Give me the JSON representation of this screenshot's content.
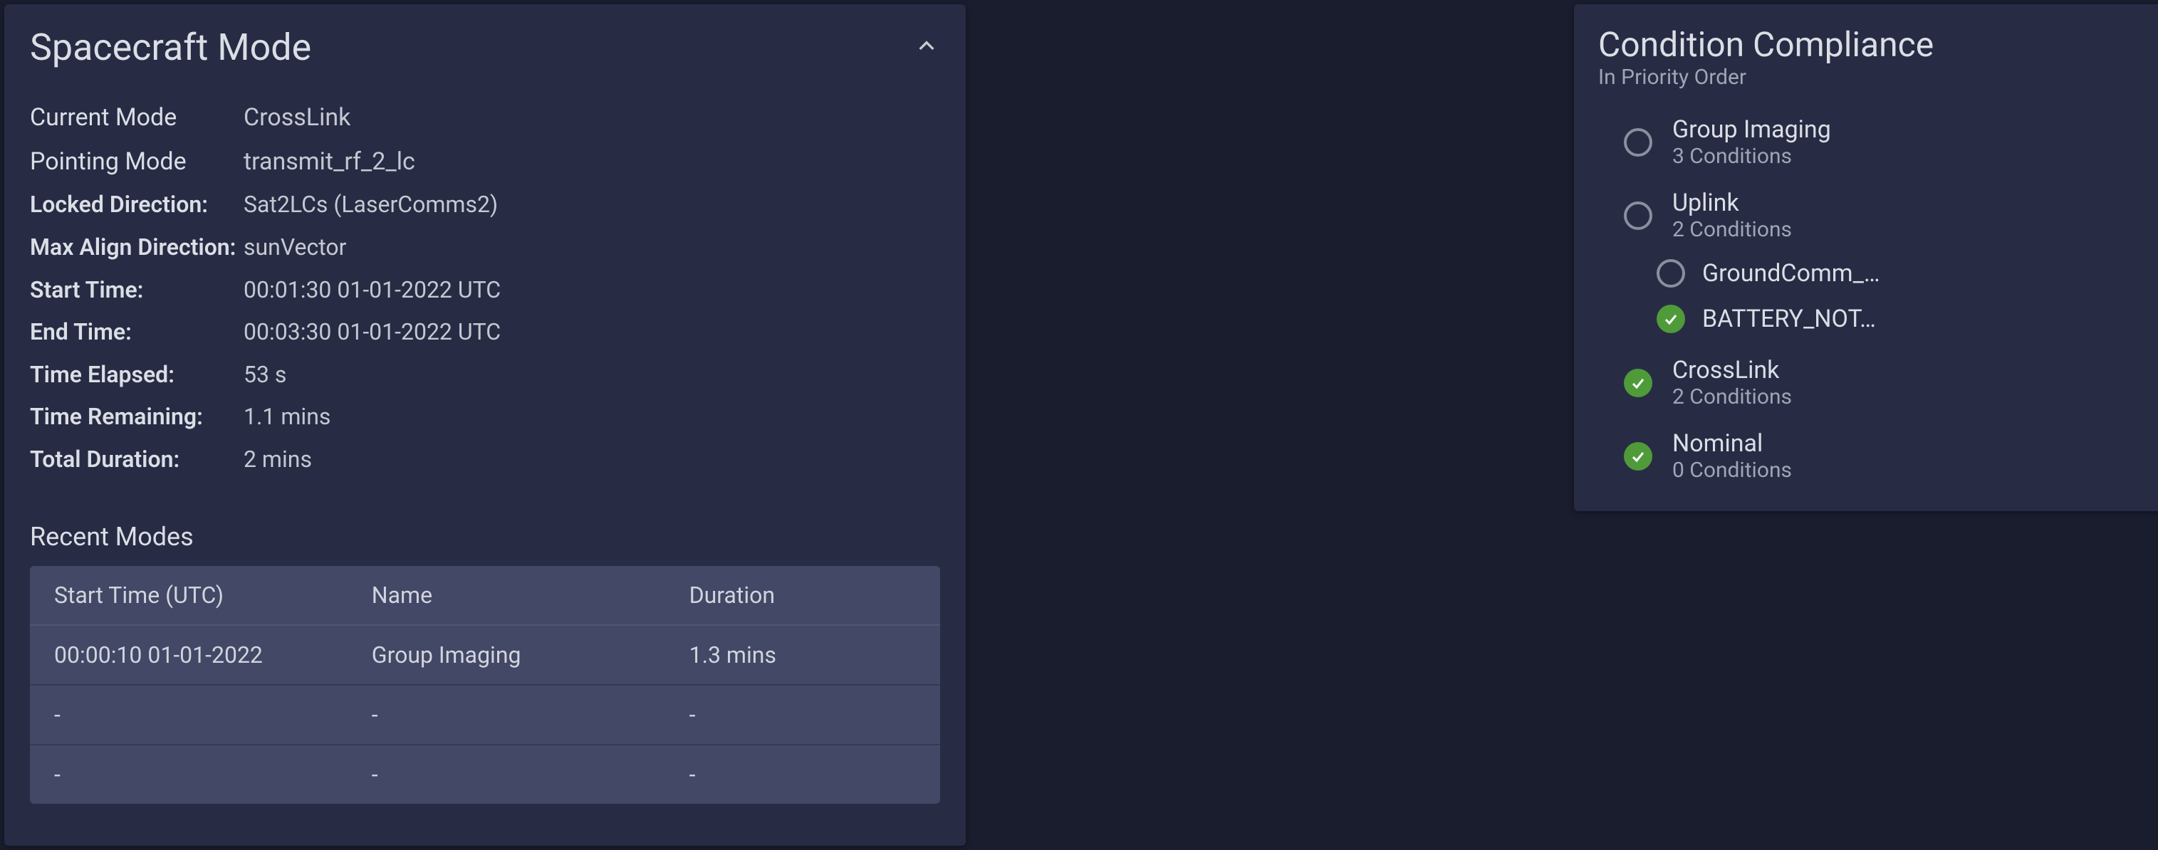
{
  "spacecraft_mode": {
    "title": "Spacecraft Mode",
    "fields": {
      "current_mode": {
        "label": "Current Mode",
        "value": "CrossLink"
      },
      "pointing_mode": {
        "label": "Pointing Mode",
        "value": "transmit_rf_2_lc"
      },
      "locked_direction": {
        "label": "Locked Direction:",
        "value": "Sat2LCs (LaserComms2)"
      },
      "max_align_direction": {
        "label": "Max Align Direction:",
        "value": "sunVector"
      },
      "start_time": {
        "label": "Start Time:",
        "value": "00:01:30 01-01-2022 UTC"
      },
      "end_time": {
        "label": "End Time:",
        "value": "00:03:30 01-01-2022 UTC"
      },
      "time_elapsed": {
        "label": "Time Elapsed:",
        "value": "53 s"
      },
      "time_remaining": {
        "label": "Time Remaining:",
        "value": "1.1 mins"
      },
      "total_duration": {
        "label": "Total Duration:",
        "value": "2 mins"
      }
    },
    "recent_modes": {
      "title": "Recent Modes",
      "columns": {
        "start": "Start Time (UTC)",
        "name": "Name",
        "duration": "Duration"
      },
      "rows": [
        {
          "start": "00:00:10 01-01-2022",
          "name": "Group Imaging",
          "duration": "1.3 mins"
        },
        {
          "start": "-",
          "name": "-",
          "duration": "-"
        },
        {
          "start": "-",
          "name": "-",
          "duration": "-"
        }
      ]
    }
  },
  "condition_compliance": {
    "title": "Condition Compliance",
    "subtitle": "In Priority Order",
    "items": [
      {
        "name": "Group Imaging",
        "conditions_label": "3 Conditions",
        "status": "empty",
        "expanded": false,
        "chevron": "down",
        "children": []
      },
      {
        "name": "Uplink",
        "conditions_label": "2 Conditions",
        "status": "empty",
        "expanded": true,
        "chevron": "up",
        "children": [
          {
            "name": "GroundComm_…",
            "status": "empty"
          },
          {
            "name": "BATTERY_NOT…",
            "status": "ok"
          }
        ]
      },
      {
        "name": "CrossLink",
        "conditions_label": "2 Conditions",
        "status": "ok",
        "expanded": false,
        "chevron": "down",
        "children": []
      },
      {
        "name": "Nominal",
        "conditions_label": "0 Conditions",
        "status": "ok",
        "expanded": false,
        "chevron": "none",
        "children": []
      }
    ]
  }
}
